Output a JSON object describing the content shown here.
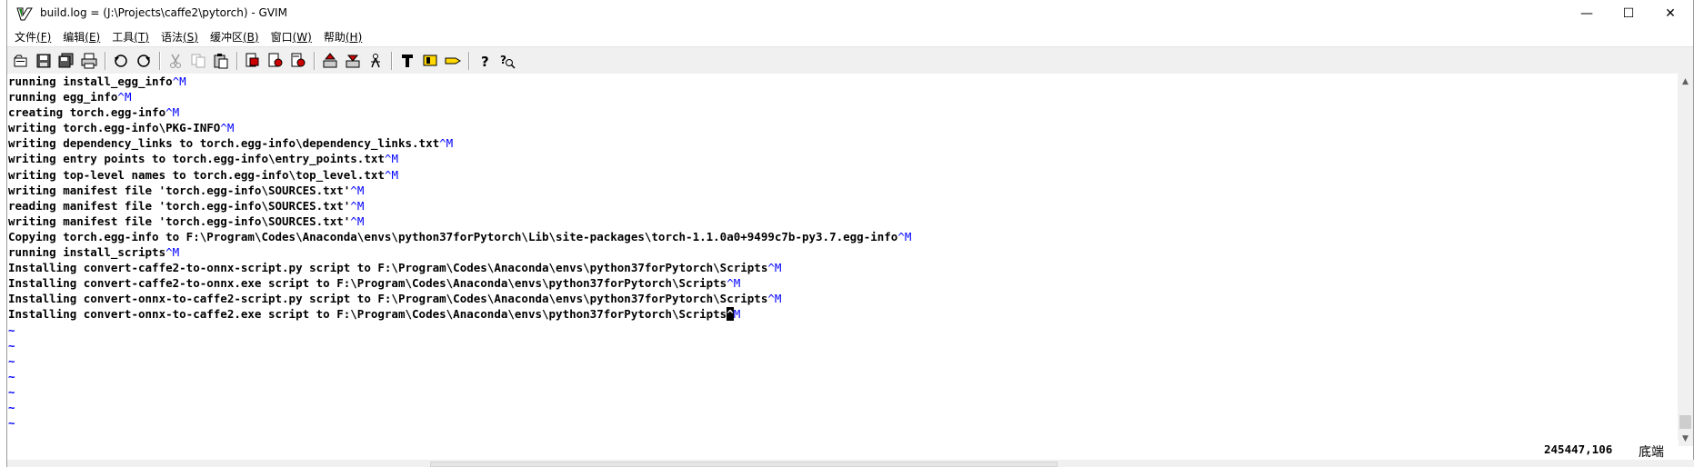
{
  "window": {
    "title": "build.log = (J:\\Projects\\caffe2\\pytorch) - GVIM",
    "minimize_glyph": "—",
    "maximize_glyph": "☐",
    "close_glyph": "✕"
  },
  "menu": [
    {
      "label": "文件",
      "accel": "(F)"
    },
    {
      "label": "编辑",
      "accel": "(E)"
    },
    {
      "label": "工具",
      "accel": "(T)"
    },
    {
      "label": "语法",
      "accel": "(S)"
    },
    {
      "label": "缓冲区",
      "accel": "(B)"
    },
    {
      "label": "窗口",
      "accel": "(W)"
    },
    {
      "label": "帮助",
      "accel": "(H)"
    }
  ],
  "toolbar_icons": [
    "open-icon",
    "save-icon",
    "save-all-icon",
    "print-icon",
    "undo-icon",
    "redo-icon",
    "cut-icon",
    "copy-icon",
    "paste-icon",
    "find-replace-icon",
    "find-next-icon",
    "find-prev-icon",
    "load-session-icon",
    "save-session-icon",
    "run-script-icon",
    "make-icon",
    "run-shell-icon",
    "tag-jump-icon",
    "help-icon",
    "find-help-icon"
  ],
  "lines": [
    {
      "text": "running install_egg_info",
      "ctl": "^M"
    },
    {
      "text": "running egg_info",
      "ctl": "^M"
    },
    {
      "text": "creating torch.egg-info",
      "ctl": "^M"
    },
    {
      "text": "writing torch.egg-info\\PKG-INFO",
      "ctl": "^M"
    },
    {
      "text": "writing dependency_links to torch.egg-info\\dependency_links.txt",
      "ctl": "^M"
    },
    {
      "text": "writing entry points to torch.egg-info\\entry_points.txt",
      "ctl": "^M"
    },
    {
      "text": "writing top-level names to torch.egg-info\\top_level.txt",
      "ctl": "^M"
    },
    {
      "text": "writing manifest file 'torch.egg-info\\SOURCES.txt'",
      "ctl": "^M"
    },
    {
      "text": "reading manifest file 'torch.egg-info\\SOURCES.txt'",
      "ctl": "^M"
    },
    {
      "text": "writing manifest file 'torch.egg-info\\SOURCES.txt'",
      "ctl": "^M"
    },
    {
      "text": "Copying torch.egg-info to F:\\Program\\Codes\\Anaconda\\envs\\python37forPytorch\\Lib\\site-packages\\torch-1.1.0a0+9499c7b-py3.7.egg-info",
      "ctl": "^M"
    },
    {
      "text": "running install_scripts",
      "ctl": "^M"
    },
    {
      "text": "Installing convert-caffe2-to-onnx-script.py script to F:\\Program\\Codes\\Anaconda\\envs\\python37forPytorch\\Scripts",
      "ctl": "^M"
    },
    {
      "text": "Installing convert-caffe2-to-onnx.exe script to F:\\Program\\Codes\\Anaconda\\envs\\python37forPytorch\\Scripts",
      "ctl": "^M"
    },
    {
      "text": "Installing convert-onnx-to-caffe2-script.py script to F:\\Program\\Codes\\Anaconda\\envs\\python37forPytorch\\Scripts",
      "ctl": "^M"
    }
  ],
  "last_line": {
    "text": "Installing convert-onnx-to-caffe2.exe script to F:\\Program\\Codes\\Anaconda\\envs\\python37forPytorch\\Scripts",
    "cursor_char": "^",
    "ctl_rest": "M"
  },
  "tilde_lines": [
    "~",
    "~",
    "~",
    "~",
    "~",
    "~",
    "~",
    "~"
  ],
  "status": {
    "position": "245447,106",
    "scroll_percent": "底端"
  }
}
